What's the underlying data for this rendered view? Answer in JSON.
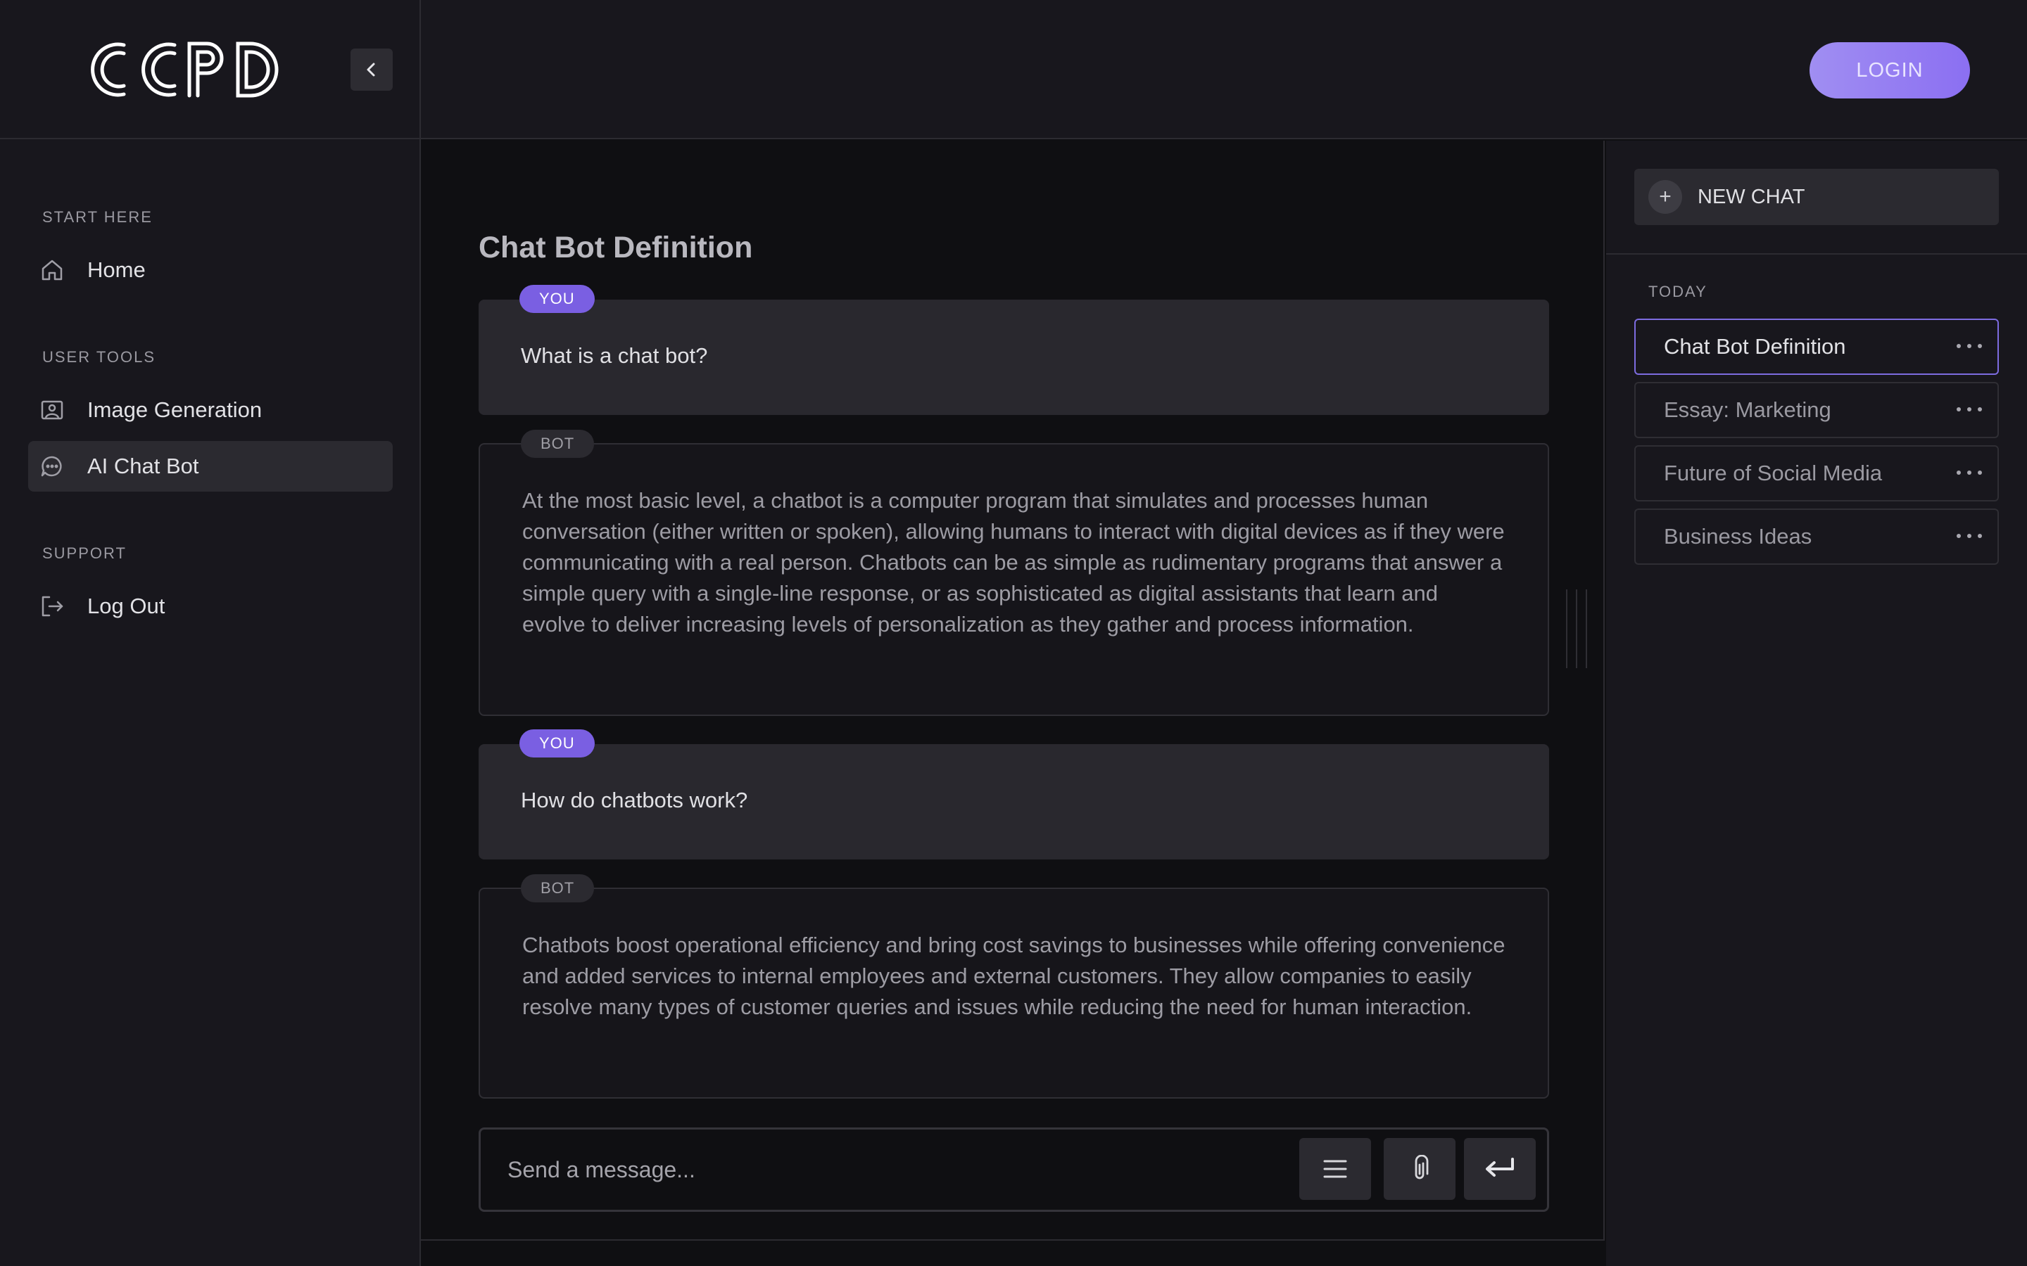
{
  "app": {
    "logo_text": "CCPD"
  },
  "header": {
    "login_label": "LOGIN"
  },
  "sidebar": {
    "sections": [
      {
        "label": "START HERE",
        "items": [
          {
            "label": "Home",
            "icon": "home-icon"
          }
        ]
      },
      {
        "label": "USER TOOLS",
        "items": [
          {
            "label": "Image Generation",
            "icon": "image-icon"
          },
          {
            "label": "AI Chat Bot",
            "icon": "chat-icon",
            "active": true
          }
        ]
      },
      {
        "label": "SUPPORT",
        "items": [
          {
            "label": "Log Out",
            "icon": "logout-icon"
          }
        ]
      }
    ]
  },
  "chat": {
    "title": "Chat Bot Definition",
    "messages": [
      {
        "role": "YOU",
        "text": "What is a chat bot?"
      },
      {
        "role": "BOT",
        "text": "At the most basic level, a chatbot is a computer program that simulates and processes human conversation (either written or spoken), allowing humans to interact with digital devices as if they were communicating with a real person. Chatbots can be as simple as rudimentary programs that answer a simple query with a single-line response, or as sophisticated as digital assistants that learn and evolve to deliver increasing levels of personalization as they gather and process information."
      },
      {
        "role": "YOU",
        "text": "How do chatbots work?"
      },
      {
        "role": "BOT",
        "text": "Chatbots boost operational efficiency and bring cost savings to businesses while offering convenience and added services to internal employees and external customers. They allow companies to easily resolve many types of customer queries and issues while reducing the need for human interaction."
      }
    ],
    "composer": {
      "placeholder": "Send a message...",
      "value": ""
    }
  },
  "history": {
    "new_chat_label": "NEW CHAT",
    "group_label": "TODAY",
    "items": [
      {
        "title": "Chat Bot Definition",
        "active": true
      },
      {
        "title": "Essay: Marketing"
      },
      {
        "title": "Future of Social Media"
      },
      {
        "title": "Business Ideas"
      }
    ]
  },
  "colors": {
    "accent": "#7a5fe2",
    "login_gradient_start": "#a08ef2",
    "login_gradient_end": "#8b6ff2",
    "background": "#0f0f12",
    "panel": "#18171d"
  }
}
